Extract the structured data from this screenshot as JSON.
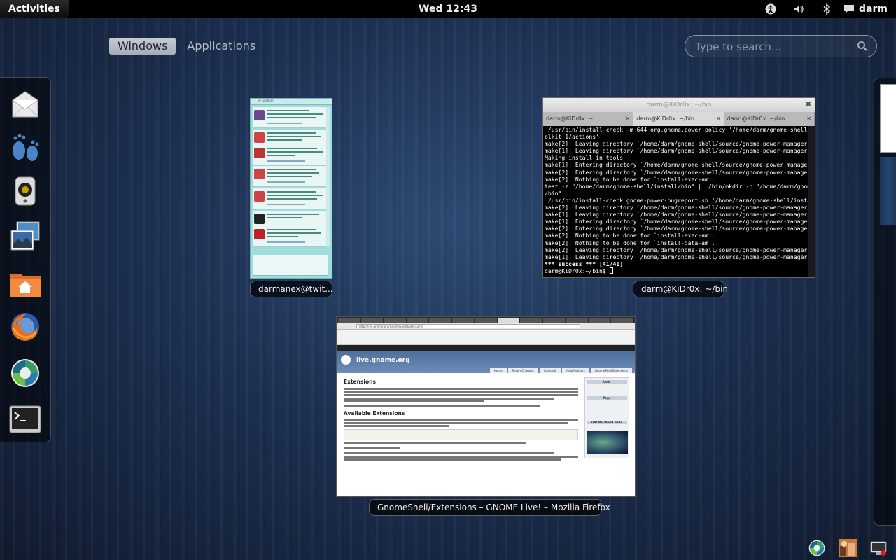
{
  "topbar": {
    "activities": "Activities",
    "clock": "Wed 12:43",
    "user": "darm",
    "icons": [
      "accessibility-icon",
      "volume-icon",
      "bluetooth-icon",
      "chat-icon"
    ]
  },
  "overview": {
    "tabs": [
      {
        "label": "Windows",
        "active": true
      },
      {
        "label": "Applications",
        "active": false
      }
    ],
    "search": {
      "placeholder": "Type to search..."
    }
  },
  "dash": {
    "apps": [
      "mail-app-icon",
      "gnome-foot-icon",
      "speaker-app-icon",
      "photos-app-icon",
      "home-folder-icon",
      "firefox-icon",
      "empathy-icon",
      "terminal-icon"
    ]
  },
  "windows": {
    "twitter": {
      "caption": "darmanex@twit...",
      "header": "by Gwibber"
    },
    "terminal": {
      "caption": "darm@KiDr0x: ~/bin",
      "title": "darm@KiDr0x: ~/bin",
      "tabs": [
        "darm@KiDr0x: ~",
        "darm@KiDr0x: ~/bin",
        "darm@KiDr0x: ~/bin"
      ],
      "lines": [
        " /usr/bin/install-check -m 644 org.gnome.power.policy '/home/darm/gnome-shell/i",
        "olkit-1/actions'",
        "make[2]: Leaving directory `/home/darm/gnome-shell/source/gnome-power-manager/p",
        "make[1]: Leaving directory `/home/darm/gnome-shell/source/gnome-power-manager/p",
        "Making install in tools",
        "make[1]: Entering directory `/home/darm/gnome-shell/source/gnome-power-manager/",
        "make[2]: Entering directory `/home/darm/gnome-shell/source/gnome-power-manager/",
        "make[2]: Nothing to be done for `install-exec-am'.",
        "test -z \"/home/darm/gnome-shell/install/bin\" || /bin/mkdir -p \"/home/darm/gnome",
        "/bin\"",
        " /usr/bin/install-check gnome-power-bugreport.sh '/home/darm/gnome-shell/instal",
        "make[2]: Leaving directory `/home/darm/gnome-shell/source/gnome-power-manager/t",
        "make[1]: Leaving directory `/home/darm/gnome-shell/source/gnome-power-manager/t",
        "make[1]: Entering directory `/home/darm/gnome-shell/source/gnome-power-manager'",
        "make[2]: Entering directory `/home/darm/gnome-shell/source/gnome-power-manager'",
        "make[2]: Nothing to be done for `install-exec-am'.",
        "make[2]: Nothing to be done for `install-data-am'.",
        "make[2]: Leaving directory `/home/darm/gnome-shell/source/gnome-power-manager'",
        "make[1]: Leaving directory `/home/darm/gnome-shell/source/gnome-power-manager'",
        "*** success *** [41/41]",
        "darm@KiDr0x:~/bin$ "
      ]
    },
    "firefox": {
      "caption": "GnomeShell/Extensions – GNOME Live! – Mozilla Firefox",
      "url": "http://live.gnome.org/GnomeShell/Extensions",
      "site_name": "live.gnome.org",
      "nav": [
        "Home",
        "RecentChanges",
        "Schedule",
        "HelpForUsers",
        "GnomeShell/Extensions"
      ],
      "heading": "Extensions",
      "subheading": "Available Extensions",
      "sidebar": [
        "User",
        "Page",
        "GNOME World Wide"
      ]
    }
  },
  "colors": {
    "topbar": "#000000",
    "background": "#1d3052",
    "terminal_bg": "#000000",
    "twitter_bg": "#9fdcdc"
  }
}
